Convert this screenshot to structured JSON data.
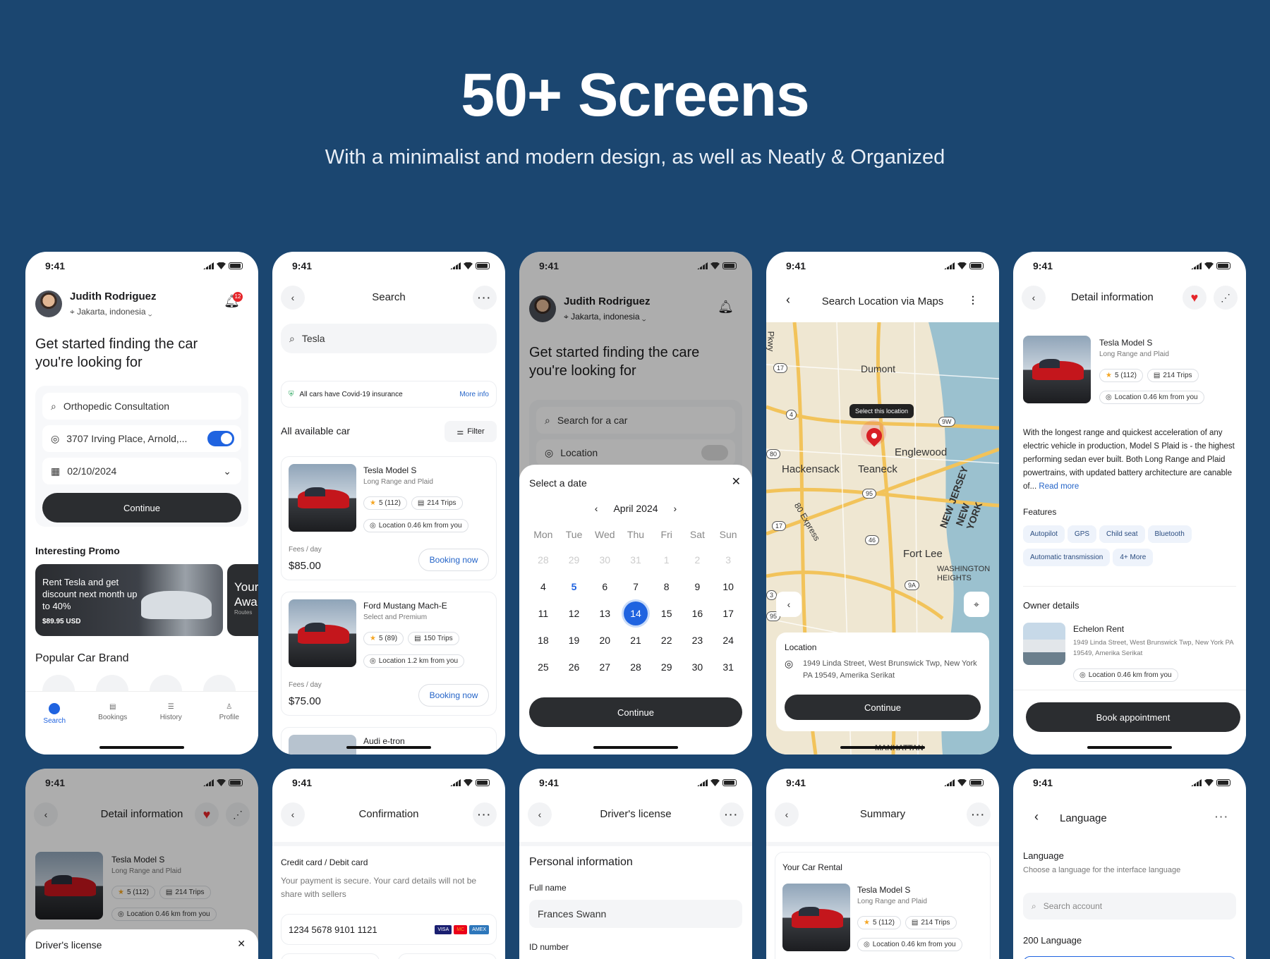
{
  "hero": {
    "title": "50+ Screens",
    "subtitle": "With a minimalist and modern design, as well as Neatly & Organized"
  },
  "status_time": "9:41",
  "home": {
    "user_name": "Judith Rodriguez",
    "location": "Jakarta, indonesia",
    "notif_count": "12",
    "headline": "Get started finding the car you're looking for",
    "search_value": "Orthopedic Consultation",
    "location_value": "3707 Irving Place, Arnold,...",
    "date_value": "02/10/2024",
    "continue": "Continue",
    "promo_heading": "Interesting Promo",
    "promo_text": "Rent Tesla and get discount next month up to 40%",
    "promo_price": "$89.95 USD",
    "promo2_title": "Your Awa",
    "promo2_sub": "Routes",
    "brand_heading": "Popular Car Brand",
    "nav": [
      "Search",
      "Bookings",
      "History",
      "Profile"
    ]
  },
  "search": {
    "title": "Search",
    "query": "Tesla",
    "insurance": "All cars have Covid-19 insurance",
    "more_info": "More info",
    "section": "All available car",
    "filter": "Filter",
    "fees_label": "Fees / day",
    "booking": "Booking now",
    "cars": [
      {
        "name": "Tesla Model S",
        "sub": "Long Range and Plaid",
        "rating": "5 (112)",
        "trips": "214 Trips",
        "loc": "Location 0.46 km from you",
        "price": "$85.00"
      },
      {
        "name": "Ford Mustang Mach-E",
        "sub": "Select and Premium",
        "rating": "5 (89)",
        "trips": "150 Trips",
        "loc": "Location 1.2 km from you",
        "price": "$75.00"
      }
    ],
    "third_car": "Audi e-tron"
  },
  "calendar": {
    "headline": "Get started finding the care you're looking for",
    "search_ph": "Search for a car",
    "location_ph": "Location",
    "select_date": "Select a date",
    "month": "April 2024",
    "days": [
      "Mon",
      "Tue",
      "Wed",
      "Thu",
      "Fri",
      "Sat",
      "Sun"
    ],
    "dates": [
      "28",
      "29",
      "30",
      "31",
      "1",
      "2",
      "3",
      "4",
      "5",
      "6",
      "7",
      "8",
      "9",
      "10",
      "11",
      "12",
      "13",
      "14",
      "15",
      "16",
      "17",
      "18",
      "19",
      "20",
      "21",
      "22",
      "23",
      "24",
      "25",
      "26",
      "27",
      "28",
      "29",
      "30",
      "31"
    ],
    "selected": "14",
    "today": "5",
    "continue": "Continue"
  },
  "map": {
    "title": "Search Location via Maps",
    "tooltip": "Select this location",
    "labels": [
      "Dumont",
      "Englewood",
      "Hackensack",
      "Teaneck",
      "Fort Lee",
      "NEW JERSEY",
      "NEW YORK",
      "WASHINGTON HEIGHTS",
      "MANHATTAN",
      "80 Express",
      "Pkwy"
    ],
    "shields": [
      "17",
      "4",
      "9W",
      "80",
      "95",
      "46",
      "17",
      "9A",
      "3",
      "95"
    ],
    "location_label": "Location",
    "address": "1949 Linda Street, West Brunswick Twp, New York PA 19549, Amerika Serikat",
    "continue": "Continue",
    "colors": {
      "map_bg": "#efe7d2",
      "road": "#f2c35a",
      "water": "#9bc1cf",
      "pin": "#d81f26"
    }
  },
  "detail": {
    "title": "Detail information",
    "car": "Tesla Model S",
    "sub": "Long Range and Plaid",
    "rating": "5 (112)",
    "trips": "214 Trips",
    "loc": "Location 0.46 km from you",
    "desc": "With the longest range and quickest acceleration of any electric vehicle in production, Model S Plaid is - the highest performing sedan ever built. Both Long Range and Plaid powertrains, with updated battery architecture are canable of...",
    "read_more": "Read more",
    "features_heading": "Features",
    "features": [
      "Autopilot",
      "GPS",
      "Child seat",
      "Bluetooth",
      "Automatic transmission",
      "4+ More"
    ],
    "owner_heading": "Owner details",
    "owner_name": "Echelon Rent",
    "owner_addr": "1949 Linda Street, West Brunswick Twp, New York PA 19549, Amerika Serikat",
    "owner_loc": "Location 0.46 km from you",
    "book": "Book appointment"
  },
  "detail2": {
    "title": "Detail information",
    "car": "Tesla Model S",
    "sub": "Long Range and Plaid",
    "rating": "5 (112)",
    "trips": "214 Trips",
    "loc": "Location 0.46 km from you",
    "sheet": "Driver's license"
  },
  "confirm": {
    "title": "Confirmation",
    "card_heading": "Credit card / Debit card",
    "note": "Your payment is secure. Your card details will not be share with sellers",
    "card_number": "1234 5678 9101 1121",
    "brands": [
      "VISA",
      "MC",
      "AMEX"
    ]
  },
  "license": {
    "title": "Driver's license",
    "section": "Personal information",
    "full_name_label": "Full name",
    "full_name": "Frances Swann",
    "id_label": "ID number"
  },
  "summary": {
    "title": "Summary",
    "rental": "Your Car Rental",
    "car": "Tesla Model S",
    "sub": "Long Range and Plaid",
    "rating": "5 (112)",
    "trips": "214 Trips",
    "loc": "Location 0.46 km from you"
  },
  "language": {
    "title": "Language",
    "label": "Language",
    "desc": "Choose a language for the interface language",
    "search_ph": "Search account",
    "count": "200 Language"
  }
}
